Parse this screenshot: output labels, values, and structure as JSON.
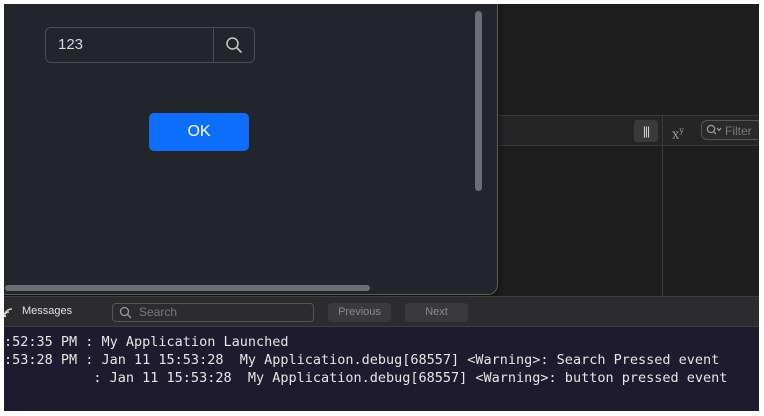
{
  "simulator": {
    "search_value": "123",
    "search_icon": "magnifying-glass",
    "ok_label": "OK"
  },
  "inspector": {
    "filter_placeholder": "Filter"
  },
  "console": {
    "messages_label": "Messages",
    "search_placeholder": "Search",
    "previous_label": "Previous",
    "next_label": "Next",
    "lines": [
      ":52:35 PM : My Application Launched",
      ":53:28 PM : Jan 11 15:53:28  My Application.debug[68557] <Warning>: Search Pressed event",
      "           : Jan 11 15:53:28  My Application.debug[68557] <Warning>: button pressed event"
    ]
  },
  "colors": {
    "accent_button": "#0d6efd",
    "console_background": "#1e1b2e"
  }
}
